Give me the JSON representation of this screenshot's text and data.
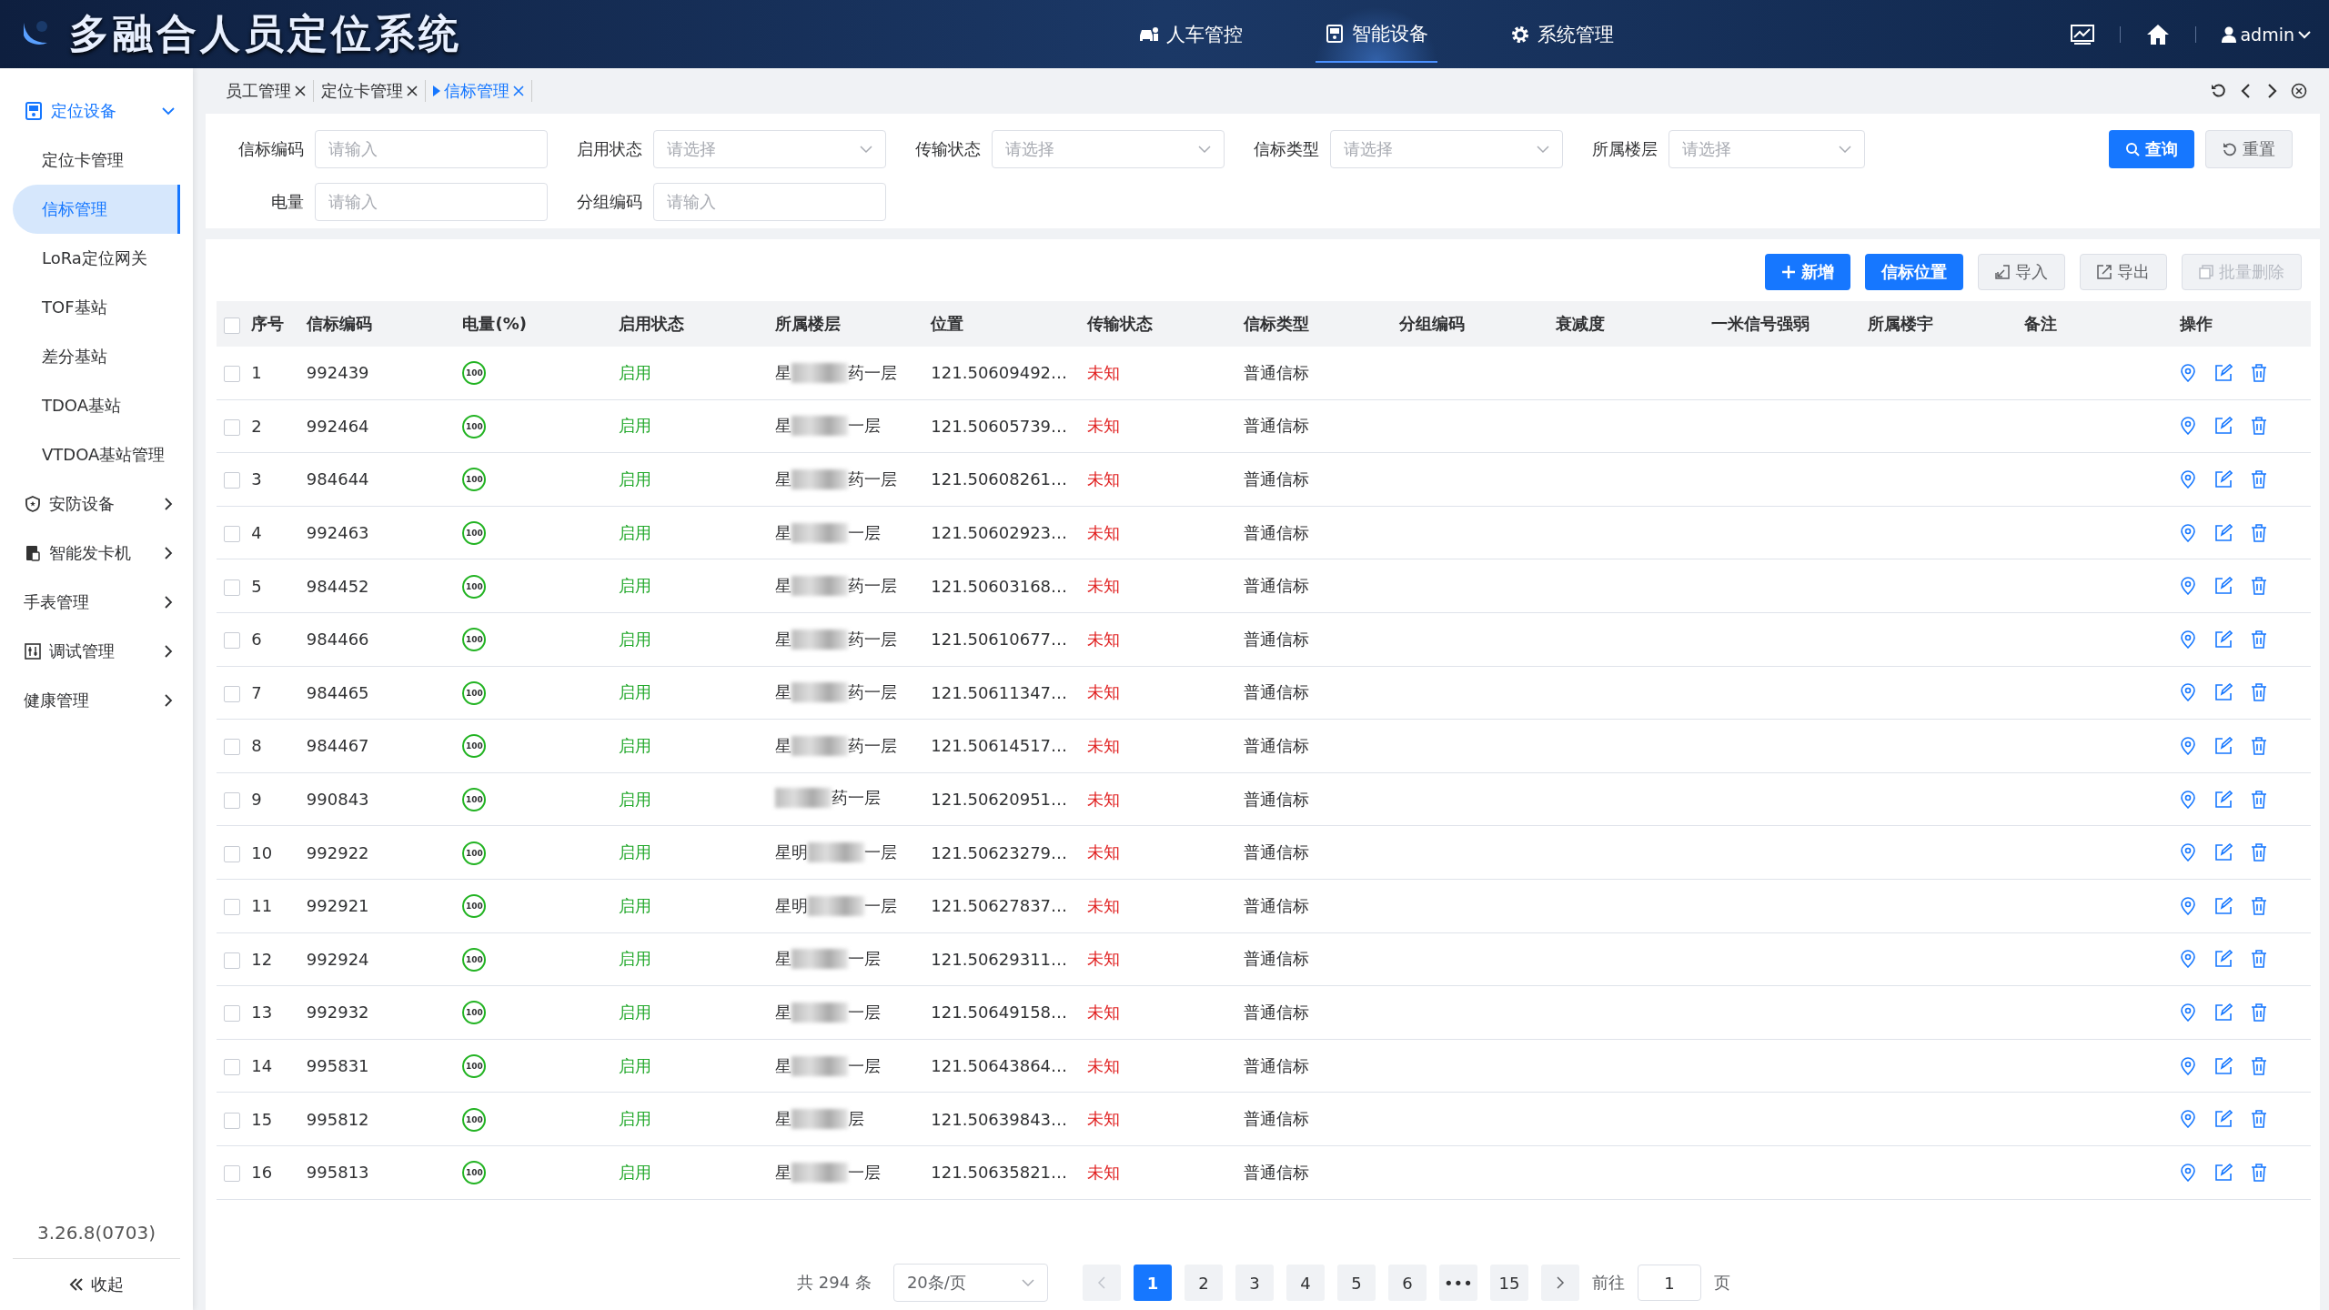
{
  "header": {
    "title": "多融合人员定位系统",
    "nav": [
      {
        "label": "人车管控",
        "kind": "car",
        "selected": false
      },
      {
        "label": "智能设备",
        "kind": "device",
        "selected": true
      },
      {
        "label": "系统管理",
        "kind": "gear",
        "selected": false
      }
    ],
    "user": "admin"
  },
  "sidebar": {
    "items": [
      {
        "label": "定位设备",
        "kind": "device",
        "expanded": true,
        "children": [
          {
            "label": "定位卡管理",
            "selected": false
          },
          {
            "label": "信标管理",
            "selected": true
          },
          {
            "label": "LoRa定位网关",
            "selected": false
          },
          {
            "label": "TOF基站",
            "selected": false
          },
          {
            "label": "差分基站",
            "selected": false
          },
          {
            "label": "TDOA基站",
            "selected": false
          },
          {
            "label": "VTDOA基站管理",
            "selected": false
          }
        ]
      },
      {
        "label": "安防设备",
        "kind": "shield",
        "expanded": false
      },
      {
        "label": "智能发卡机",
        "kind": "card",
        "expanded": false
      },
      {
        "label": "手表管理",
        "kind": "plain",
        "expanded": false
      },
      {
        "label": "调试管理",
        "kind": "sliders",
        "expanded": false
      },
      {
        "label": "健康管理",
        "kind": "plain",
        "expanded": false
      }
    ],
    "version": "3.26.8(0703)",
    "collapse": "收起"
  },
  "tabs": [
    {
      "label": "员工管理",
      "selected": false
    },
    {
      "label": "定位卡管理",
      "selected": false
    },
    {
      "label": "信标管理",
      "selected": true
    }
  ],
  "filters": [
    {
      "label": "信标编码",
      "kind": "input",
      "placeholder": "请输入"
    },
    {
      "label": "启用状态",
      "kind": "select",
      "placeholder": "请选择"
    },
    {
      "label": "传输状态",
      "kind": "select",
      "placeholder": "请选择"
    },
    {
      "label": "信标类型",
      "kind": "select",
      "placeholder": "请选择"
    },
    {
      "label": "所属楼层",
      "kind": "select",
      "placeholder": "请选择"
    },
    {
      "label": "电量",
      "kind": "input",
      "placeholder": "请输入"
    },
    {
      "label": "分组编码",
      "kind": "input",
      "placeholder": "请输入"
    }
  ],
  "filter_buttons": [
    {
      "label": "查询",
      "kind": "primary"
    },
    {
      "label": "重置",
      "kind": "plain"
    }
  ],
  "toolbar": [
    {
      "label": "新增",
      "kind": "primary",
      "disabled": false
    },
    {
      "label": "信标位置",
      "kind": "primary",
      "disabled": false
    },
    {
      "label": "导入",
      "kind": "plain",
      "disabled": false
    },
    {
      "label": "导出",
      "kind": "plain",
      "disabled": false
    },
    {
      "label": "批量删除",
      "kind": "plain",
      "disabled": true
    }
  ],
  "table": {
    "select_all_checked": false,
    "columns": [
      "序号",
      "信标编码",
      "电量(%)",
      "启用状态",
      "所属楼层",
      "位置",
      "传输状态",
      "信标类型",
      "分组编码",
      "衰减度",
      "一米信号强弱",
      "所属楼宇",
      "备注",
      "操作"
    ],
    "rows": [
      {
        "index": "1",
        "code": "992439",
        "battery": "100",
        "enabled": "启用",
        "floor_start": "星",
        "floor_end": "药一层",
        "position": "121.50609492…",
        "transfer": "未知",
        "type": "普通信标",
        "checked": false
      },
      {
        "index": "2",
        "code": "992464",
        "battery": "100",
        "enabled": "启用",
        "floor_start": "星",
        "floor_end": "一层",
        "position": "121.50605739…",
        "transfer": "未知",
        "type": "普通信标",
        "checked": false
      },
      {
        "index": "3",
        "code": "984644",
        "battery": "100",
        "enabled": "启用",
        "floor_start": "星",
        "floor_end": "药一层",
        "position": "121.50608261…",
        "transfer": "未知",
        "type": "普通信标",
        "checked": false
      },
      {
        "index": "4",
        "code": "992463",
        "battery": "100",
        "enabled": "启用",
        "floor_start": "星",
        "floor_end": "一层",
        "position": "121.50602923…",
        "transfer": "未知",
        "type": "普通信标",
        "checked": false
      },
      {
        "index": "5",
        "code": "984452",
        "battery": "100",
        "enabled": "启用",
        "floor_start": "星",
        "floor_end": "药一层",
        "position": "121.50603168…",
        "transfer": "未知",
        "type": "普通信标",
        "checked": false
      },
      {
        "index": "6",
        "code": "984466",
        "battery": "100",
        "enabled": "启用",
        "floor_start": "星",
        "floor_end": "药一层",
        "position": "121.50610677…",
        "transfer": "未知",
        "type": "普通信标",
        "checked": false
      },
      {
        "index": "7",
        "code": "984465",
        "battery": "100",
        "enabled": "启用",
        "floor_start": "星",
        "floor_end": "药一层",
        "position": "121.50611347…",
        "transfer": "未知",
        "type": "普通信标",
        "checked": false
      },
      {
        "index": "8",
        "code": "984467",
        "battery": "100",
        "enabled": "启用",
        "floor_start": "星",
        "floor_end": "药一层",
        "position": "121.50614517…",
        "transfer": "未知",
        "type": "普通信标",
        "checked": false
      },
      {
        "index": "9",
        "code": "990843",
        "battery": "100",
        "enabled": "启用",
        "floor_end": "药一层",
        "position": "121.50620951…",
        "transfer": "未知",
        "type": "普通信标",
        "checked": false
      },
      {
        "index": "10",
        "code": "992922",
        "battery": "100",
        "enabled": "启用",
        "floor_start": "星明",
        "floor_end": "一层",
        "position": "121.50623279…",
        "transfer": "未知",
        "type": "普通信标",
        "checked": false
      },
      {
        "index": "11",
        "code": "992921",
        "battery": "100",
        "enabled": "启用",
        "floor_start": "星明",
        "floor_end": "一层",
        "position": "121.50627837…",
        "transfer": "未知",
        "type": "普通信标",
        "checked": false
      },
      {
        "index": "12",
        "code": "992924",
        "battery": "100",
        "enabled": "启用",
        "floor_start": "星",
        "floor_end": "一层",
        "position": "121.50629311…",
        "transfer": "未知",
        "type": "普通信标",
        "checked": false
      },
      {
        "index": "13",
        "code": "992932",
        "battery": "100",
        "enabled": "启用",
        "floor_start": "星",
        "floor_end": "一层",
        "position": "121.50649158…",
        "transfer": "未知",
        "type": "普通信标",
        "checked": false
      },
      {
        "index": "14",
        "code": "995831",
        "battery": "100",
        "enabled": "启用",
        "floor_start": "星",
        "floor_end": "一层",
        "position": "121.50643864…",
        "transfer": "未知",
        "type": "普通信标",
        "checked": false
      },
      {
        "index": "15",
        "code": "995812",
        "battery": "100",
        "enabled": "启用",
        "floor_start": "星",
        "floor_end": "层",
        "position": "121.50639843…",
        "transfer": "未知",
        "type": "普通信标",
        "checked": false
      },
      {
        "index": "16",
        "code": "995813",
        "battery": "100",
        "enabled": "启用",
        "floor_start": "星",
        "floor_end": "一层",
        "position": "121.50635821…",
        "transfer": "未知",
        "type": "普通信标",
        "checked": false
      }
    ]
  },
  "pagination": {
    "total": "共 294 条",
    "page_size": "20条/页",
    "pages": [
      {
        "label": "1",
        "selected": true
      },
      {
        "label": "2",
        "selected": false
      },
      {
        "label": "3",
        "selected": false
      },
      {
        "label": "4",
        "selected": false
      },
      {
        "label": "5",
        "selected": false
      },
      {
        "label": "6",
        "selected": false
      },
      {
        "label": "•••",
        "selected": false
      },
      {
        "label": "15",
        "selected": false
      }
    ],
    "goto": "前往",
    "goto_value": "1",
    "page_unit": "页"
  }
}
